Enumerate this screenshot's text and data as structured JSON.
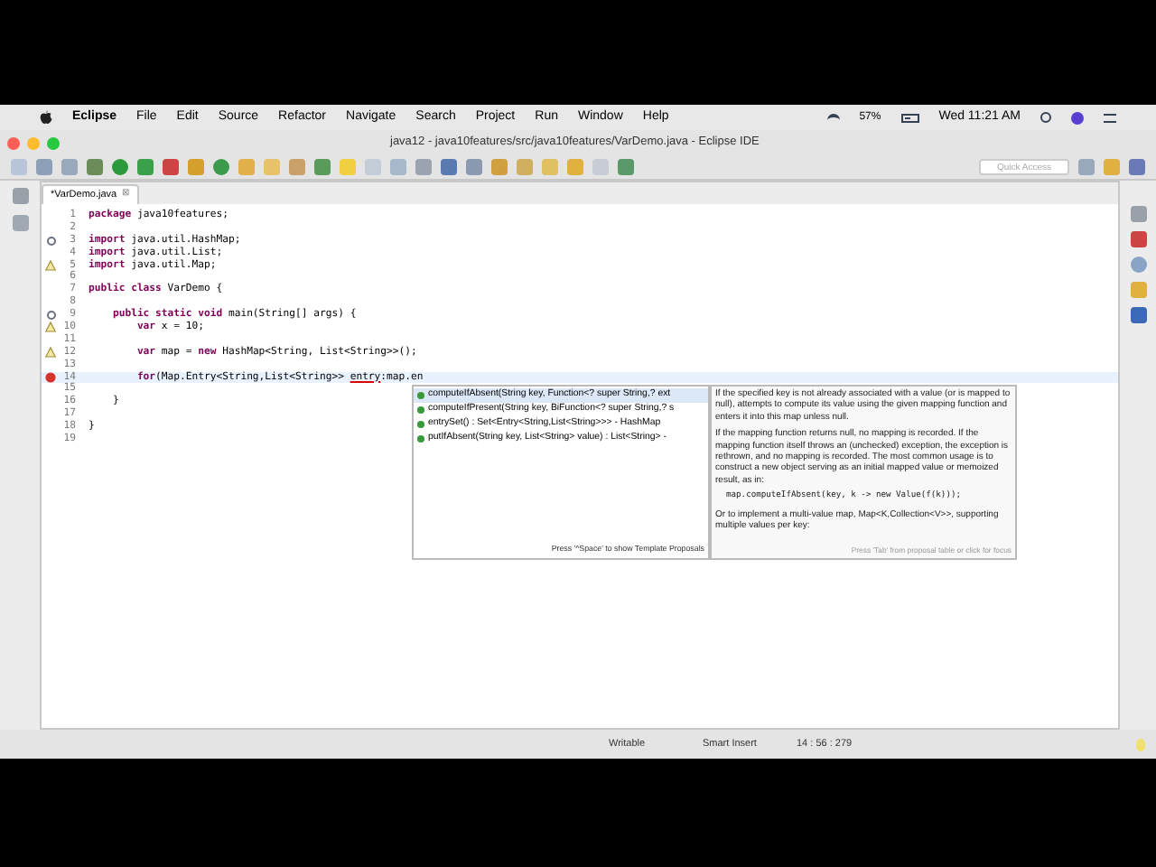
{
  "menubar": {
    "items": [
      {
        "label": "Eclipse",
        "app": true
      },
      {
        "label": "File",
        "app": false
      },
      {
        "label": "Edit",
        "app": false
      },
      {
        "label": "Source",
        "app": false
      },
      {
        "label": "Refactor",
        "app": false
      },
      {
        "label": "Navigate",
        "app": false
      },
      {
        "label": "Search",
        "app": false
      },
      {
        "label": "Project",
        "app": false
      },
      {
        "label": "Run",
        "app": false
      },
      {
        "label": "Window",
        "app": false
      },
      {
        "label": "Help",
        "app": false
      }
    ],
    "battery": "57%",
    "clock": "Wed 11:21 AM"
  },
  "window": {
    "title": "java12 - java10features/src/java10features/VarDemo.java - Eclipse IDE"
  },
  "toolbar": {
    "quick_access": {
      "placeholder": "Quick Access"
    }
  },
  "editor": {
    "tab": {
      "label": "*VarDemo.java",
      "close": "⊠"
    },
    "lines": [
      {
        "number": "1",
        "foldable": false,
        "warning": false,
        "error": false,
        "current": false,
        "tokens": [
          {
            "kind": "kw",
            "text": "package"
          },
          {
            "kind": "txt",
            "text": " java10features;"
          }
        ]
      },
      {
        "number": "2",
        "foldable": false,
        "warning": false,
        "error": false,
        "current": false
      },
      {
        "number": "3",
        "foldable": true,
        "warning": false,
        "error": false,
        "current": false,
        "tokens": [
          {
            "kind": "kw",
            "text": "import"
          },
          {
            "kind": "txt",
            "text": " java.util.HashMap;"
          }
        ]
      },
      {
        "number": "4",
        "foldable": false,
        "warning": false,
        "error": false,
        "current": false,
        "tokens": [
          {
            "kind": "kw",
            "text": "import"
          },
          {
            "kind": "txt",
            "text": " java.util.List;"
          }
        ]
      },
      {
        "number": "5",
        "foldable": false,
        "warning": true,
        "error": false,
        "current": false,
        "tokens": [
          {
            "kind": "kw",
            "text": "import"
          },
          {
            "kind": "txt",
            "text": " java.util.Map;"
          }
        ]
      },
      {
        "number": "6",
        "foldable": false,
        "warning": false,
        "error": false,
        "current": false
      },
      {
        "number": "7",
        "foldable": false,
        "warning": false,
        "error": false,
        "current": false,
        "tokens": [
          {
            "kind": "kw",
            "text": "public class"
          },
          {
            "kind": "txt",
            "text": " VarDemo {"
          }
        ]
      },
      {
        "number": "8",
        "foldable": false,
        "warning": false,
        "error": false,
        "current": false
      },
      {
        "number": "9",
        "foldable": true,
        "warning": false,
        "error": false,
        "current": false,
        "tokens": [
          {
            "kind": "kw",
            "text": "    public static void"
          },
          {
            "kind": "txt",
            "text": " main(String[] args) {"
          }
        ]
      },
      {
        "number": "10",
        "foldable": false,
        "warning": true,
        "error": false,
        "current": false,
        "tokens": [
          {
            "kind": "kw",
            "text": "        var"
          },
          {
            "kind": "txt",
            "text": " x = 10;"
          }
        ]
      },
      {
        "number": "11",
        "foldable": false,
        "warning": false,
        "error": false,
        "current": false
      },
      {
        "number": "12",
        "foldable": false,
        "warning": true,
        "error": false,
        "current": false,
        "tokens": [
          {
            "kind": "kw",
            "text": "        var"
          },
          {
            "kind": "txt",
            "text": " map = "
          },
          {
            "kind": "kw",
            "text": "new"
          },
          {
            "kind": "txt",
            "text": " HashMap<String, List<String>>();"
          }
        ]
      },
      {
        "number": "13",
        "foldable": false,
        "warning": false,
        "error": false,
        "current": false
      },
      {
        "number": "14",
        "foldable": false,
        "warning": false,
        "error": true,
        "current": true,
        "tokens": [
          {
            "kind": "kw",
            "text": "        for"
          },
          {
            "kind": "txt",
            "text": "(Map.Entry<String,List<String>> "
          },
          {
            "kind": "ul",
            "text": "entry"
          },
          {
            "kind": "txt",
            "text": ":map.en"
          }
        ]
      },
      {
        "number": "15",
        "foldable": false,
        "warning": false,
        "error": false,
        "current": false
      },
      {
        "number": "16",
        "foldable": false,
        "warning": false,
        "error": false,
        "current": false,
        "tokens": [
          {
            "kind": "txt",
            "text": "    }"
          }
        ]
      },
      {
        "number": "17",
        "foldable": false,
        "warning": false,
        "error": false,
        "current": false
      },
      {
        "number": "18",
        "foldable": false,
        "warning": false,
        "error": false,
        "current": false,
        "tokens": [
          {
            "kind": "txt",
            "text": "}"
          }
        ]
      },
      {
        "number": "19",
        "foldable": false,
        "warning": false,
        "error": false,
        "current": false
      }
    ]
  },
  "proposals": {
    "items": [
      {
        "label": "computeIfAbsent(String key, Function<? super String,? ext",
        "selected": true
      },
      {
        "label": "computeIfPresent(String key, BiFunction<? super String,? s",
        "selected": false
      },
      {
        "label": "entrySet() : Set<Entry<String,List<String>>> - HashMap",
        "selected": false
      },
      {
        "label": "putIfAbsent(String key, List<String> value) : List<String> -",
        "selected": false
      }
    ],
    "footer": "Press '^Space' to show Template Proposals"
  },
  "doc": {
    "paragraphs": [
      "If the specified key is not already associated with a value (or is mapped to null), attempts to compute its value using the given mapping function and enters it into this map unless null.",
      "If the mapping function returns null, no mapping is recorded. If the mapping function itself throws an (unchecked) exception, the exception is rethrown, and no mapping is recorded. The most common usage is to construct a new object serving as an initial mapped value or memoized result, as in:",
      "map.computeIfAbsent(key, k -> new Value(f(k)));",
      "Or to implement a multi-value map, Map<K,Collection<V>>, supporting multiple values per key:"
    ],
    "footer": "Press 'Tab' from proposal table or click for focus"
  },
  "status_bar": {
    "fields": [
      "Writable",
      "Smart Insert",
      "14 : 56 : 279"
    ]
  }
}
